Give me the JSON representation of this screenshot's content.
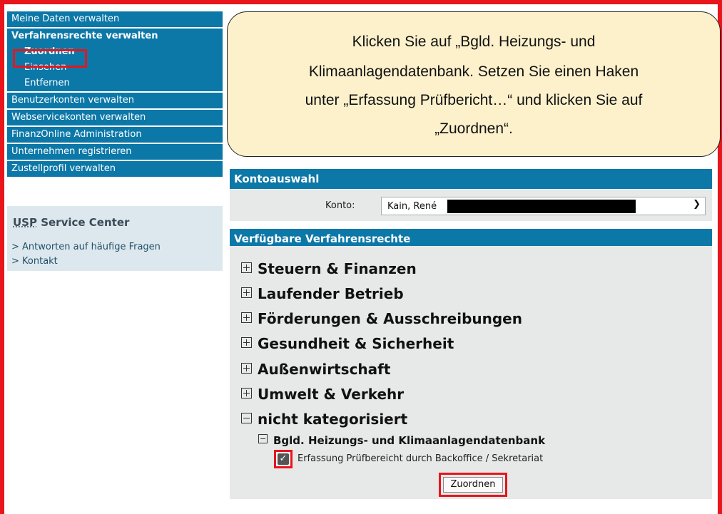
{
  "sidebar": {
    "items": [
      {
        "label": "Meine Daten verwalten"
      },
      {
        "label": "Verfahrensrechte verwalten"
      },
      {
        "label": "Zuordnen"
      },
      {
        "label": "Einsehen"
      },
      {
        "label": "Entfernen"
      },
      {
        "label": "Benutzerkonten verwalten"
      },
      {
        "label": "Webservicekonten verwalten"
      },
      {
        "label": "FinanzOnline Administration"
      },
      {
        "label": "Unternehmen registrieren"
      },
      {
        "label": "Zustellprofil verwalten"
      }
    ],
    "service_center": {
      "title_prefix": "USP",
      "title_rest": " Service Center",
      "links": [
        "> Antworten auf häufige Fragen",
        "> Kontakt"
      ]
    }
  },
  "callout": {
    "lines": [
      "Klicken Sie auf „Bgld. Heizungs- und",
      "Klimaanlagendatenbank. Setzen Sie einen Haken",
      "unter „Erfassung Prüfbericht…“ und klicken Sie auf",
      "„Zuordnen“."
    ]
  },
  "konto": {
    "header": "Kontoauswahl",
    "label": "Konto:",
    "selected": "Kain, René"
  },
  "rights": {
    "header": "Verfügbare Verfahrensrechte",
    "categories": [
      "Steuern & Finanzen",
      "Laufender Betrieb",
      "Förderungen & Ausschreibungen",
      "Gesundheit & Sicherheit",
      "Außenwirtschaft",
      "Umwelt & Verkehr",
      "nicht kategorisiert"
    ],
    "subcategory": "Bgld. Heizungs- und Klimaanlagendatenbank",
    "checkbox_label": "Erfassung Prüfbereicht durch Backoffice / Sekretariat",
    "checkbox_checked": true,
    "button": "Zuordnen"
  },
  "colors": {
    "accent": "#0c78a8",
    "highlight": "#e8151b",
    "callout_bg": "#fdf1cc"
  }
}
